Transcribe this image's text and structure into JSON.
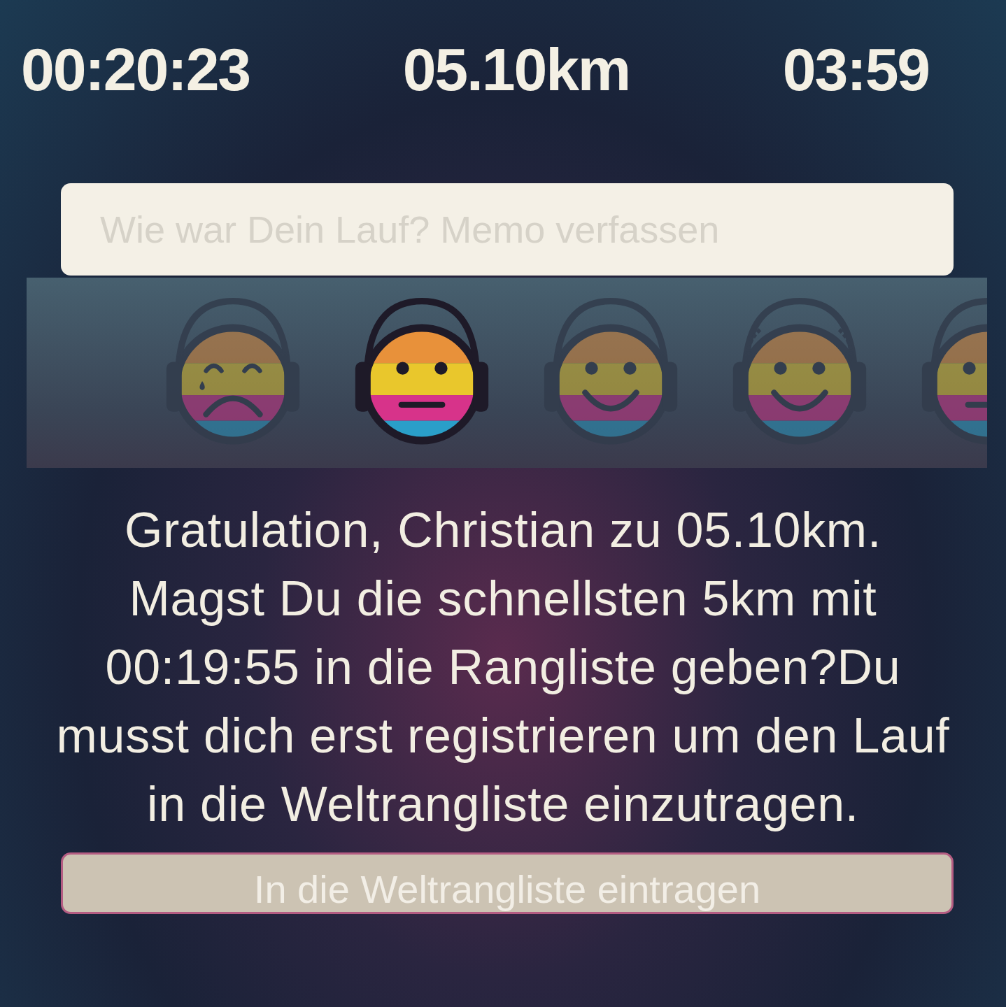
{
  "stats": [
    "00:20:23",
    "05.10km",
    "03:59"
  ],
  "memo": {
    "placeholder": "Wie war Dein Lauf? Memo verfassen"
  },
  "moods": [
    {
      "kind": "sad",
      "selected": false
    },
    {
      "kind": "neutral",
      "selected": true
    },
    {
      "kind": "happy",
      "selected": false
    },
    {
      "kind": "laurel",
      "selected": false
    },
    {
      "kind": "neutral",
      "selected": false
    }
  ],
  "message": "Gratulation, Christian zu 05.10km. Magst Du die schnellsten 5km mit 00:19:55 in die Rangliste geben?Du musst dich erst registrieren um den Lauf in die Weltrangliste einzutragen.",
  "button": {
    "label": "In die Weltrangliste eintragen"
  }
}
